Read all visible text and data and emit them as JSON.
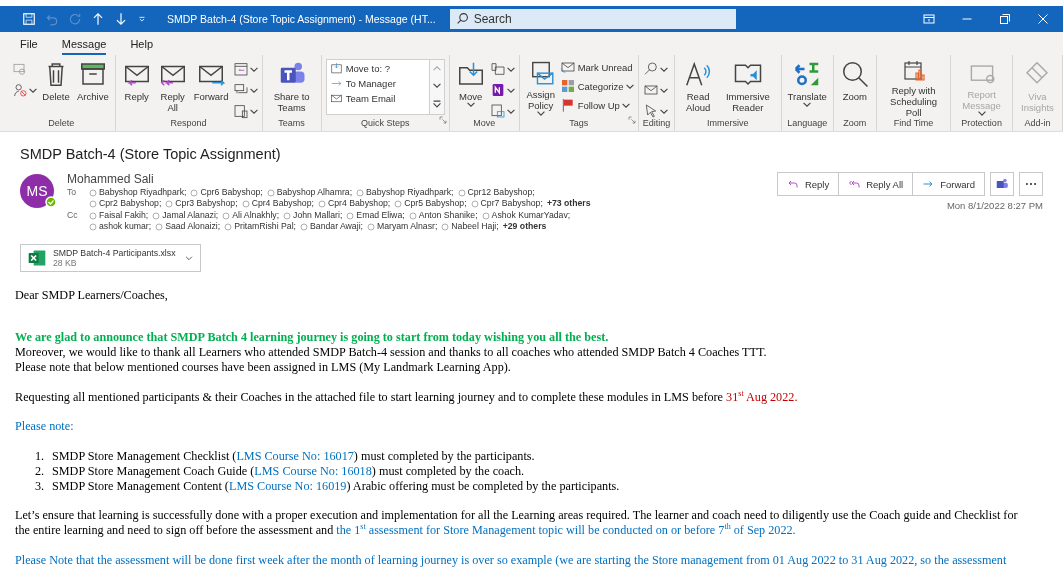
{
  "window": {
    "title": "SMDP Batch-4 (Store Topic Assignment)  -  Message (HT...",
    "search": {
      "placeholder": "Search"
    }
  },
  "menu": [
    {
      "label": "File",
      "selected": false
    },
    {
      "label": "Message",
      "selected": true
    },
    {
      "label": "Help",
      "selected": false
    }
  ],
  "ribbon": [
    {
      "label": "Delete",
      "items": [
        {
          "kind": "stack"
        },
        {
          "kind": "large",
          "label": "Delete",
          "disabled": false
        },
        {
          "kind": "large",
          "label": "Archive",
          "disabled": false
        }
      ]
    },
    {
      "label": "Respond",
      "items": [
        {
          "kind": "large",
          "label": "Reply",
          "disabled": false
        },
        {
          "kind": "large",
          "label": "Reply All",
          "disabled": false
        },
        {
          "kind": "large",
          "label": "Forward",
          "disabled": false
        },
        {
          "kind": "stack"
        }
      ]
    },
    {
      "label": "Teams",
      "items": [
        {
          "kind": "large",
          "label": "Share to Teams",
          "disabled": false
        }
      ]
    },
    {
      "label": "Quick Steps",
      "launcher": true,
      "items": [
        {
          "kind": "quicksteps",
          "steps": [
            "Move to: ?",
            "To Manager",
            "Team Email"
          ]
        }
      ]
    },
    {
      "label": "Move",
      "items": [
        {
          "kind": "large",
          "label": "Move",
          "disabled": false,
          "dropdown": true
        },
        {
          "kind": "stack"
        }
      ]
    },
    {
      "label": "Tags",
      "launcher": true,
      "items": [
        {
          "kind": "large",
          "label": "Assign Policy",
          "disabled": false,
          "dropdown": true
        },
        {
          "kind": "smalls",
          "entries": [
            {
              "label": "Mark Unread",
              "dropdown": false
            },
            {
              "label": "Categorize",
              "dropdown": true
            },
            {
              "label": "Follow Up",
              "dropdown": true
            }
          ]
        }
      ]
    },
    {
      "label": "Editing",
      "items": [
        {
          "kind": "stack"
        }
      ]
    },
    {
      "label": "Immersive",
      "items": [
        {
          "kind": "large",
          "label": "Read Aloud",
          "disabled": false
        },
        {
          "kind": "large",
          "label": "Immersive Reader",
          "disabled": false
        }
      ]
    },
    {
      "label": "Language",
      "items": [
        {
          "kind": "large",
          "label": "Translate",
          "disabled": false,
          "dropdown": true
        }
      ]
    },
    {
      "label": "Zoom",
      "items": [
        {
          "kind": "large",
          "label": "Zoom",
          "disabled": false
        }
      ]
    },
    {
      "label": "Find Time",
      "items": [
        {
          "kind": "large",
          "label": "Reply with Scheduling Poll",
          "disabled": false
        }
      ]
    },
    {
      "label": "Protection",
      "items": [
        {
          "kind": "large",
          "label": "Report Message",
          "disabled": true,
          "dropdown": true
        }
      ]
    },
    {
      "label": "Add-in",
      "items": [
        {
          "kind": "large",
          "label": "Viva Insights",
          "disabled": true
        }
      ]
    }
  ],
  "message": {
    "subject": "SMDP Batch-4 (Store Topic Assignment)",
    "initials": "MS",
    "sender": "Mohammed Sali",
    "to": {
      "label": "To",
      "lines": [
        [
          "Babyshop Riyadhpark;",
          "Cpr6 Babyshop;",
          "Babyshop Alhamra;",
          "Babyshop Riyadhpark;",
          "Cpr12 Babyshop;"
        ],
        [
          "Cpr2 Babyshop;",
          "Cpr3 Babyshop;",
          "Cpr4 Babyshop;",
          "Cpr4 Babyshop;",
          "Cpr5 Babyshop;",
          "Cpr7 Babyshop;"
        ]
      ],
      "more": "+73 others"
    },
    "cc": {
      "label": "Cc",
      "lines": [
        [
          "Faisal Fakih;",
          "Jamal Alanazi;",
          "Ali Alnakhly;",
          "John Mallari;",
          "Emad Eliwa;",
          "Anton Shanike;",
          "Ashok KumarYadav;"
        ],
        [
          "ashok kumar;",
          "Saad Alonaizi;",
          "PritamRishi Pal;",
          "Bandar  Awaji;",
          "Maryam Alnasr;",
          "Nabeel Haji;"
        ]
      ],
      "more": "+29 others"
    },
    "actions": [
      "Reply",
      "Reply All",
      "Forward"
    ],
    "date": "Mon 8/1/2022 8:27 PM",
    "attachment": {
      "name": "SMDP Batch-4 Participants.xlsx",
      "size": "28 KB"
    }
  },
  "body": [
    {
      "kind": "para",
      "lines": [
        [
          {
            "text": "Dear SMDP Learners/Coaches,"
          }
        ]
      ]
    },
    {
      "kind": "para",
      "lines": [
        [
          {
            "text": "We are glad to announce that SMDP Batch 4 learning journey is going to start from today wishing you all the best.",
            "color": "#00b050",
            "bold": true
          }
        ],
        [
          {
            "text": "Moreover, we would like to thank all Learners who attended SMDP Batch-4 session and thanks to all coaches who attended SMDP Batch 4 Coaches TTT."
          }
        ],
        [
          {
            "text": "Please note that below mentioned courses have been assigned in LMS (My Landmark Learning App)."
          }
        ]
      ]
    },
    {
      "kind": "para",
      "lines": [
        [
          {
            "text": "Requesting all mentioned participants & their Coaches in the attached file to start learning journey and to complete these modules in LMS before "
          },
          {
            "text": "31$^{st}$ Aug 2022.",
            "color": "#c00000"
          }
        ]
      ]
    },
    {
      "kind": "para",
      "lines": [
        [
          {
            "text": "Please note:",
            "color": "#0070c0"
          }
        ]
      ]
    },
    {
      "kind": "list",
      "items": [
        {
          "number": "1.",
          "runs": [
            {
              "text": "SMDP Store Management Checklist ("
            },
            {
              "text": "LMS Course No: 16017",
              "color": "#0070c0"
            },
            {
              "text": ") must completed by the participants."
            }
          ]
        },
        {
          "number": "2.",
          "runs": [
            {
              "text": "SMDP Store Management Coach Guide ("
            },
            {
              "text": "LMS Course No: 16018",
              "color": "#0070c0"
            },
            {
              "text": ") must completed by the coach."
            }
          ]
        },
        {
          "number": "3.",
          "runs": [
            {
              "text": "SMDP Store Management Content ("
            },
            {
              "text": "LMS Course No: 16019",
              "color": "#0070c0"
            },
            {
              "text": ") Arabic offering must be completed by the participants."
            }
          ]
        }
      ]
    },
    {
      "kind": "para",
      "lines": [
        [
          {
            "text": "Let’s ensure that learning is successfully done with a proper execution and implementation for all the Learning areas required. The learner and coach need to diligently use the Coach guide and Checklist for"
          }
        ],
        [
          {
            "text": "the entire learning and need to sign off before the assessment and "
          },
          {
            "text": "the 1$^{st}$ assessment for Store Management topic will be conducted on or before 7$^{th}$ of Sep 2022.",
            "color": "#0070c0"
          }
        ]
      ]
    },
    {
      "kind": "para",
      "lines": [
        [
          {
            "text": "Please Note that the assessment will be done first week after the month of learning journey is over so example (we are starting the Store management from 01 Aug 2022 to 31 Aug 2022, so the assessment",
            "color": "#0070c0"
          }
        ]
      ]
    }
  ]
}
